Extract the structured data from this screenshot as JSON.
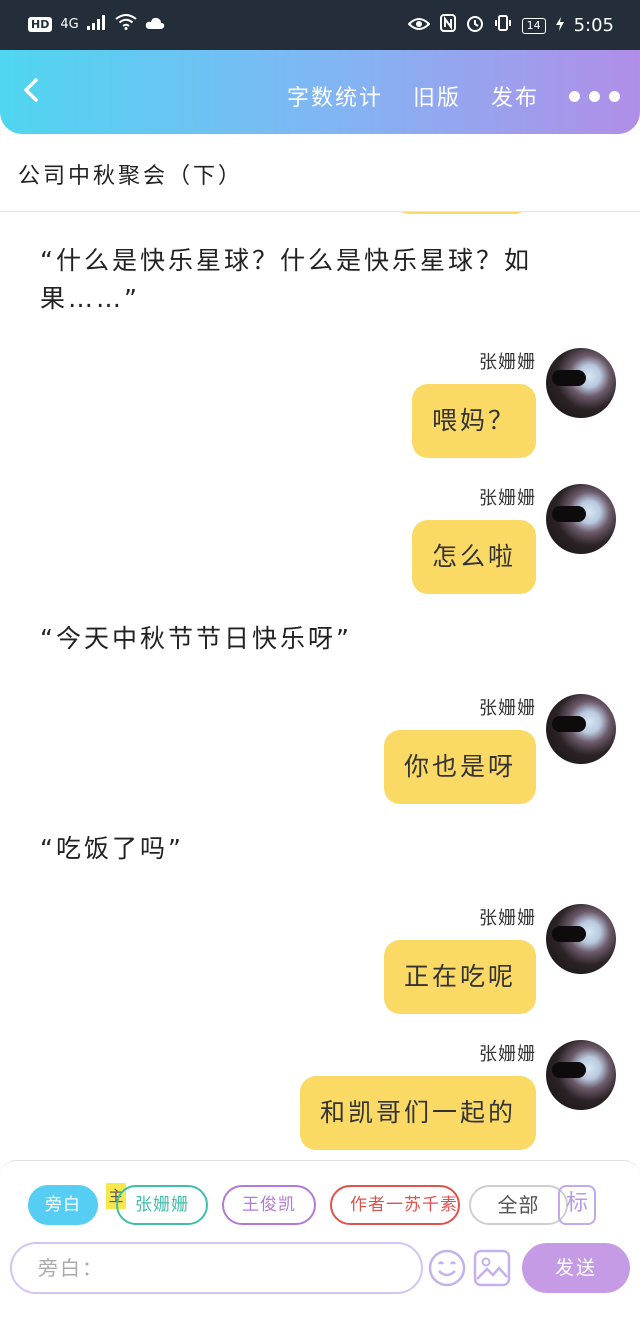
{
  "status_bar": {
    "hd": "HD",
    "network": "4G",
    "battery": "14",
    "time": "5:05"
  },
  "header": {
    "word_count": "字数统计",
    "old_version": "旧版",
    "publish": "发布"
  },
  "story_title": "公司中秋聚会（下）",
  "chat": [
    {
      "type": "narration",
      "text": "“什么是快乐星球？什么是快乐星球？如果……”"
    },
    {
      "type": "message",
      "sender": "张姗姗",
      "text": "喂妈？"
    },
    {
      "type": "message",
      "sender": "张姗姗",
      "text": "怎么啦"
    },
    {
      "type": "narration",
      "text": "“今天中秋节节日快乐呀”"
    },
    {
      "type": "message",
      "sender": "张姗姗",
      "text": "你也是呀"
    },
    {
      "type": "narration",
      "text": "“吃饭了吗”"
    },
    {
      "type": "message",
      "sender": "张姗姗",
      "text": "正在吃呢"
    },
    {
      "type": "message",
      "sender": "张姗姗",
      "text": "和凯哥们一起的"
    }
  ],
  "roles": {
    "narrator": "旁白",
    "main_tag": "主",
    "role1": "张姗姗",
    "role2": "王俊凯",
    "role3": "作者一苏千素",
    "all": "全部",
    "tag_button": "标"
  },
  "input": {
    "placeholder": "旁白："
  },
  "send": "发送",
  "colors": {
    "header_gradient_start": "#4fd6f0",
    "header_gradient_end": "#b18ee8",
    "bubble": "#fbd965",
    "send_button": "#c59be6"
  }
}
